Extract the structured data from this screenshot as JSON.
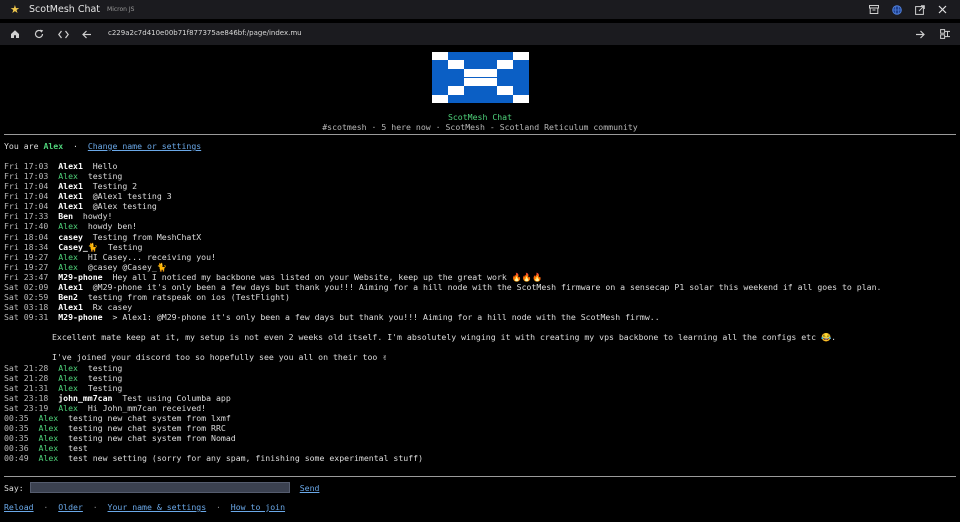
{
  "window": {
    "title": "ScotMesh Chat",
    "subtitle": "Micron JS",
    "controls": [
      "archive-icon",
      "globe-icon",
      "external-link-icon",
      "close-icon"
    ]
  },
  "nav": {
    "url": "c229a2c7d410e00b71f877375ae846bf:/page/index.mu",
    "buttons": [
      "home-icon",
      "reload-icon",
      "code-icon",
      "back-icon",
      "forward-icon",
      "layout-icon"
    ]
  },
  "colors": {
    "accent": "#4fd27a",
    "link": "#6aa8e8",
    "flag_blue": "#0b5fc5",
    "flag_white": "#ffffff"
  },
  "header": {
    "title": "ScotMesh Chat",
    "subtitle": "#scotmesh · 5 here now · ScotMesh - Scotland Reticulum community"
  },
  "user": {
    "prefix": "You are ",
    "name": "Alex",
    "sep": "  ·  ",
    "settings_link": "Change name or settings"
  },
  "messages": [
    {
      "time": "Fri 17:03",
      "nick": "Alex1",
      "self": false,
      "text": "Hello"
    },
    {
      "time": "Fri 17:03",
      "nick": "Alex",
      "self": true,
      "text": "testing"
    },
    {
      "time": "Fri 17:04",
      "nick": "Alex1",
      "self": false,
      "text": "Testing 2"
    },
    {
      "time": "Fri 17:04",
      "nick": "Alex1",
      "self": false,
      "text": "@Alex1 testing 3"
    },
    {
      "time": "Fri 17:04",
      "nick": "Alex1",
      "self": false,
      "text": "@Alex testing"
    },
    {
      "time": "Fri 17:33",
      "nick": "Ben",
      "self": false,
      "text": "howdy!"
    },
    {
      "time": "Fri 17:40",
      "nick": "Alex",
      "self": true,
      "text": "howdy ben!"
    },
    {
      "time": "Fri 18:04",
      "nick": "casey",
      "self": false,
      "text": "Testing from MeshChatX"
    },
    {
      "time": "Fri 18:34",
      "nick": "Casey_🐈",
      "self": false,
      "text": "Testing"
    },
    {
      "time": "Fri 19:27",
      "nick": "Alex",
      "self": true,
      "text": "HI Casey... receiving you!"
    },
    {
      "time": "Fri 19:27",
      "nick": "Alex",
      "self": true,
      "text": "@casey @Casey_🐈"
    },
    {
      "time": "Fri 23:47",
      "nick": "M29-phone",
      "self": false,
      "text": "Hey all I noticed my backbone was listed on your Website, keep up the great work 🔥🔥🔥"
    },
    {
      "time": "Sat 02:09",
      "nick": "Alex1",
      "self": false,
      "text": "@M29-phone it's only been a few days but thank you!!! Aiming for a hill node with the ScotMesh firmware on a sensecap P1 solar this weekend if all goes to plan."
    },
    {
      "time": "Sat 02:59",
      "nick": "Ben2",
      "self": false,
      "text": "testing from ratspeak on ios (TestFlight)"
    },
    {
      "time": "Sat 03:18",
      "nick": "Alex1",
      "self": false,
      "text": "Rx casey"
    },
    {
      "time": "Sat 09:31",
      "nick": "M29-phone",
      "self": false,
      "text": "> Alex1: @M29-phone it's only been a few days but thank you!!! Aiming for a hill node with the ScotMesh firmw.."
    },
    {
      "cont": true,
      "text": ""
    },
    {
      "cont": true,
      "text": "Excellent mate keep at it, my setup is not even 2 weeks old itself. I'm absolutely winging it with creating my vps backbone to learning all the configs etc 😂."
    },
    {
      "cont": true,
      "text": ""
    },
    {
      "cont": true,
      "text": "I've joined your discord too so hopefully see you all on their too ✌"
    },
    {
      "time": "Sat 21:28",
      "nick": "Alex",
      "self": true,
      "text": "testing"
    },
    {
      "time": "Sat 21:28",
      "nick": "Alex",
      "self": true,
      "text": "testing"
    },
    {
      "time": "Sat 21:31",
      "nick": "Alex",
      "self": true,
      "text": "Testing"
    },
    {
      "time": "Sat 23:18",
      "nick": "john_mm7can",
      "self": false,
      "text": "Test using Columba app"
    },
    {
      "time": "Sat 23:19",
      "nick": "Alex",
      "self": true,
      "text": "Hi John_mm7can received!"
    },
    {
      "time": "00:35",
      "nick": "Alex",
      "self": true,
      "text": "testing new chat system from lxmf"
    },
    {
      "time": "00:35",
      "nick": "Alex",
      "self": true,
      "text": "testing new chat system from RRC"
    },
    {
      "time": "00:35",
      "nick": "Alex",
      "self": true,
      "text": "testing new chat system from Nomad"
    },
    {
      "time": "00:36",
      "nick": "Alex",
      "self": true,
      "text": "test"
    },
    {
      "time": "00:49",
      "nick": "Alex",
      "self": true,
      "text": "test new setting (sorry for any spam, finishing some experimental stuff)"
    }
  ],
  "composer": {
    "label": "Say:",
    "value": "",
    "send": "Send"
  },
  "footer": {
    "links": [
      "Reload",
      "Older",
      "Your name & settings",
      "How to join"
    ],
    "sep": "  ·  "
  }
}
